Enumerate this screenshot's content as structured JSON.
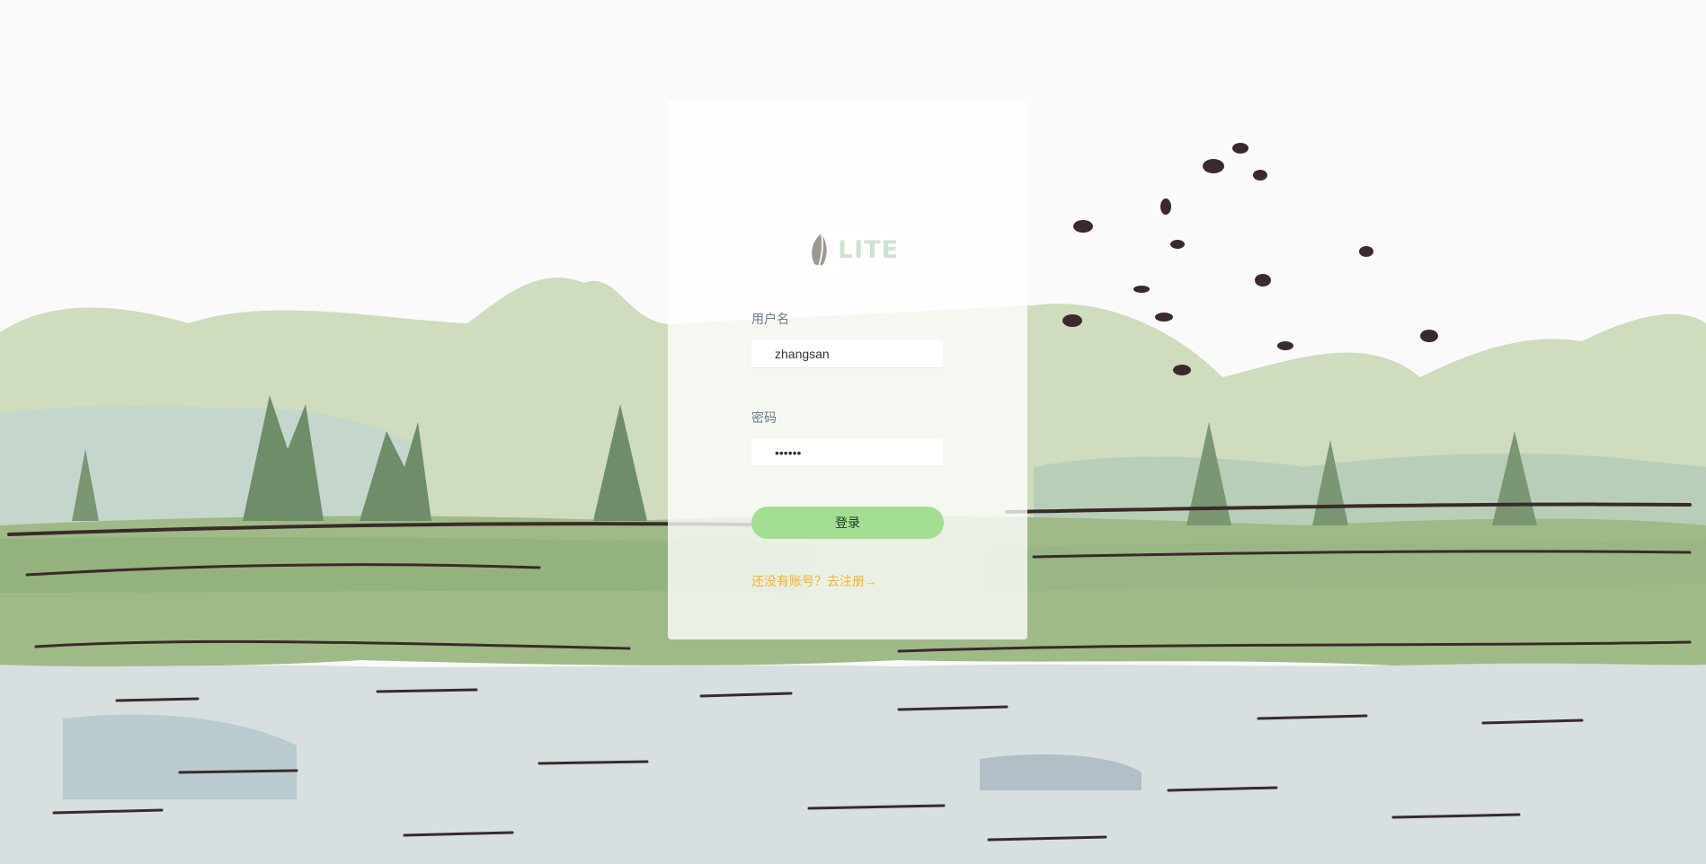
{
  "login_form": {
    "logo_text": "LITE",
    "username_label": "用户名",
    "username_value": "zhangsan",
    "password_label": "密码",
    "password_value": "••••••",
    "login_button_label": "登录",
    "register_link_label": "还没有账号？去注册→"
  },
  "colors": {
    "button": "#a3df93",
    "link": "#f5b424",
    "logo": "#cde3cf",
    "background_hills": "#cfdcbd",
    "background_water": "#d7dfe0"
  }
}
